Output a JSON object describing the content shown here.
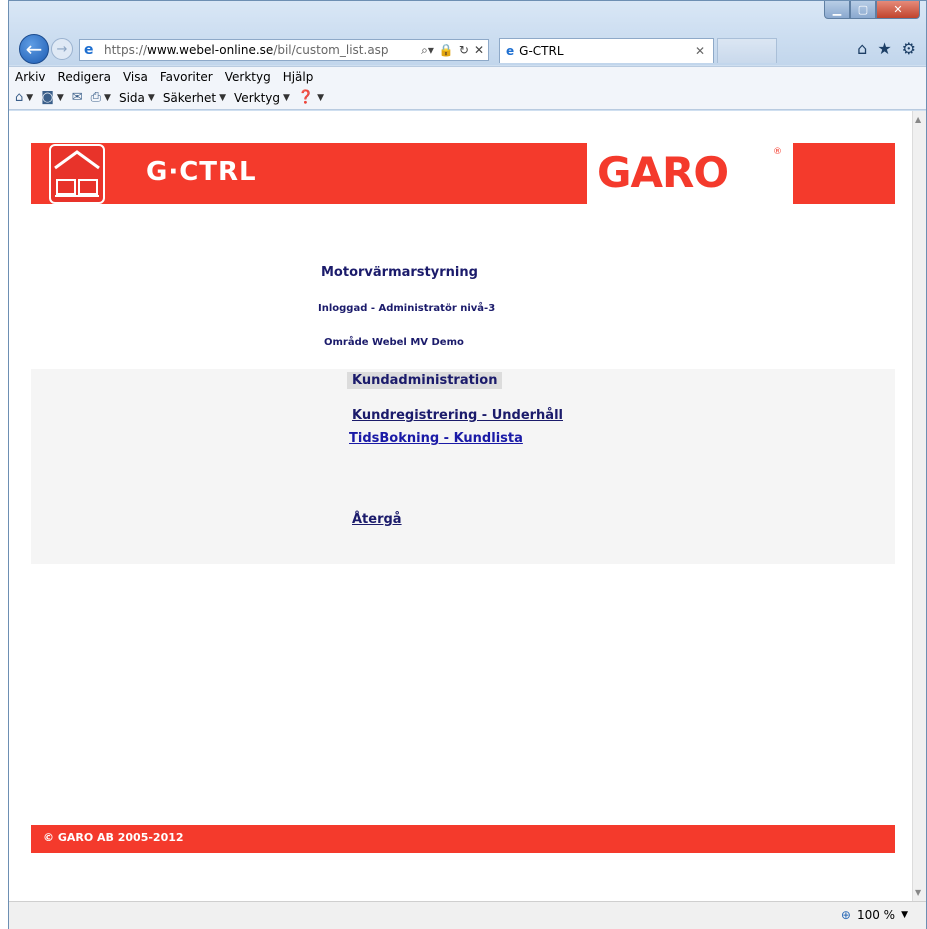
{
  "browser": {
    "url_scheme": "https://",
    "url_host": "www.webel-online.se",
    "url_path": "/bil/custom_list.asp",
    "tab_title": "G-CTRL",
    "zoom": "100 %"
  },
  "menubar": [
    "Arkiv",
    "Redigera",
    "Visa",
    "Favoriter",
    "Verktyg",
    "Hjälp"
  ],
  "commandbar": {
    "page": "Sida",
    "safety": "Säkerhet",
    "tools": "Verktyg"
  },
  "header": {
    "brand": "G·CTRL",
    "logo_text": "GARO",
    "registered": "®"
  },
  "page": {
    "title": "Motorvärmarstyrning",
    "login_status": "Inloggad - Administratör nivå-3",
    "area": "Område Webel MV Demo"
  },
  "admin": {
    "heading": "Kundadministration",
    "links": {
      "customer_registration": "Kundregistrering - Underhåll",
      "time_booking": "TidsBokning - Kundlista",
      "back": "Återgå"
    }
  },
  "footer": {
    "copyright": "© GARO AB 2005-2012"
  },
  "colors": {
    "brand_red": "#f43a2c",
    "text_navy": "#1b1b6b"
  }
}
